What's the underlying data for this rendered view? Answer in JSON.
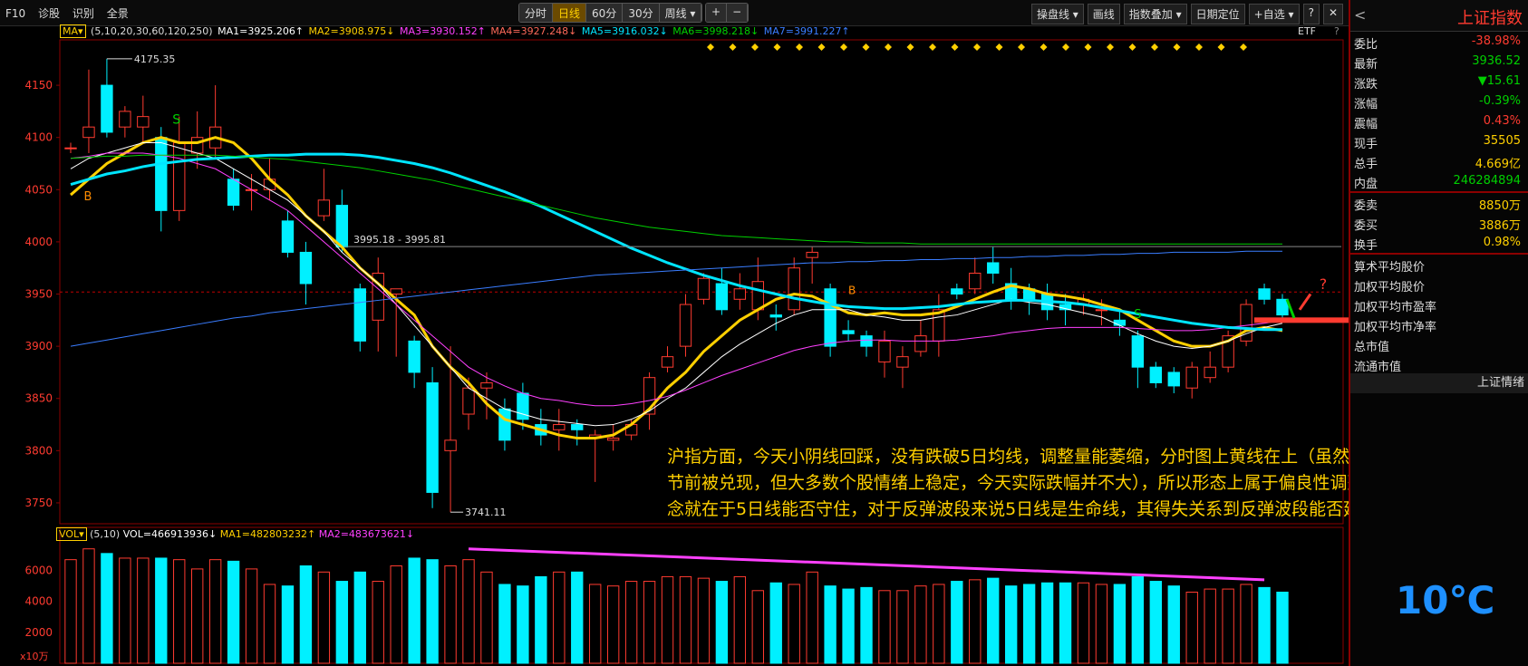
{
  "topbar": {
    "left_items": [
      "F10",
      "诊股",
      "识别",
      "全景"
    ],
    "periods": [
      "分时",
      "日线",
      "60分",
      "30分",
      "周线 ▾"
    ],
    "active_period": "日线",
    "zoom": [
      "+",
      "−"
    ],
    "right_items": [
      "操盘线 ▾",
      "画线",
      "指数叠加 ▾",
      "日期定位",
      "+自选 ▾",
      "?",
      "✕"
    ]
  },
  "ma_bar": {
    "selector": "MA▾",
    "params": "(5,10,20,30,60,120,250)",
    "items": [
      {
        "text": "MA1=3925.206↑",
        "color": "#ffffff"
      },
      {
        "text": "MA2=3908.975↓",
        "color": "#ffd000"
      },
      {
        "text": "MA3=3930.152↑",
        "color": "#ff40ff"
      },
      {
        "text": "MA4=3927.248↓",
        "color": "#ff6a5a"
      },
      {
        "text": "MA5=3916.032↓",
        "color": "#00e5ff"
      },
      {
        "text": "MA6=3998.218↓",
        "color": "#00d000"
      },
      {
        "text": "MA7=3991.227↑",
        "color": "#3a7dff"
      }
    ],
    "etf": "ETF",
    "q": "?"
  },
  "vol_bar": {
    "selector": "VOL▾",
    "params": "(5,10)",
    "items": [
      {
        "text": "VOL=466913936↓",
        "color": "#ffffff"
      },
      {
        "text": "MA1=482803232↑",
        "color": "#ffd000"
      },
      {
        "text": "MA2=483673621↓",
        "color": "#ff40ff"
      }
    ]
  },
  "chart_data": {
    "type": "candlestick",
    "y_ticks": [
      4150,
      4100,
      4050,
      4000,
      3950,
      3900,
      3850,
      3800,
      3750
    ],
    "ylim": [
      3730,
      4190
    ],
    "candles": [
      [
        4090,
        4090,
        4095,
        4085
      ],
      [
        4100,
        4110,
        4165,
        4085
      ],
      [
        4150,
        4105,
        4175.35,
        4100
      ],
      [
        4110,
        4125,
        4130,
        4100
      ],
      [
        4110,
        4120,
        4140,
        4095
      ],
      [
        4100,
        4030,
        4110,
        4010
      ],
      [
        4030,
        4095,
        4120,
        4020
      ],
      [
        4085,
        4100,
        4125,
        4070
      ],
      [
        4090,
        4110,
        4150,
        4080
      ],
      [
        4060,
        4035,
        4070,
        4030
      ],
      [
        4050,
        4050,
        4065,
        4030
      ],
      [
        4050,
        4060,
        4080,
        4040
      ],
      [
        4020,
        3990,
        4030,
        3985
      ],
      [
        3990,
        3960,
        4000,
        3940
      ],
      [
        4025,
        4040,
        4070,
        4020
      ],
      [
        4035,
        3995,
        4050,
        3990
      ],
      [
        3955,
        3905,
        3960,
        3895
      ],
      [
        3925,
        3970,
        3985,
        3895
      ],
      [
        3950,
        3955,
        3955,
        3890
      ],
      [
        3905,
        3875,
        3910,
        3860
      ],
      [
        3865,
        3760,
        3880,
        3745
      ],
      [
        3800,
        3810,
        3900,
        3741.11
      ],
      [
        3835,
        3860,
        3870,
        3820
      ],
      [
        3860,
        3865,
        3875,
        3830
      ],
      [
        3840,
        3810,
        3850,
        3800
      ],
      [
        3855,
        3830,
        3865,
        3820
      ],
      [
        3825,
        3815,
        3840,
        3805
      ],
      [
        3820,
        3825,
        3840,
        3800
      ],
      [
        3825,
        3820,
        3830,
        3805
      ],
      [
        3812,
        3815,
        3820,
        3770
      ],
      [
        3810,
        3812,
        3825,
        3800
      ],
      [
        3815,
        3825,
        3830,
        3810
      ],
      [
        3835,
        3870,
        3875,
        3820
      ],
      [
        3880,
        3890,
        3900,
        3875
      ],
      [
        3900,
        3940,
        3950,
        3890
      ],
      [
        3945,
        3965,
        3970,
        3940
      ],
      [
        3960,
        3935,
        3975,
        3930
      ],
      [
        3945,
        3955,
        3970,
        3935
      ],
      [
        3935,
        3962,
        3985,
        3925
      ],
      [
        3930,
        3928,
        3940,
        3915
      ],
      [
        3935,
        3975,
        3985,
        3930
      ],
      [
        3985,
        3990,
        3995,
        3960
      ],
      [
        3955,
        3900,
        3960,
        3890
      ],
      [
        3915,
        3912,
        3925,
        3905
      ],
      [
        3910,
        3900,
        3915,
        3890
      ],
      [
        3885,
        3905,
        3915,
        3870
      ],
      [
        3880,
        3890,
        3900,
        3860
      ],
      [
        3895,
        3910,
        3925,
        3890
      ],
      [
        3905,
        3935,
        3950,
        3890
      ],
      [
        3955,
        3950,
        3960,
        3945
      ],
      [
        3955,
        3970,
        3985,
        3950
      ],
      [
        3980,
        3970,
        3995,
        3960
      ],
      [
        3960,
        3945,
        3975,
        3935
      ],
      [
        3955,
        3945,
        3960,
        3930
      ],
      [
        3950,
        3935,
        3960,
        3925
      ],
      [
        3940,
        3935,
        3950,
        3920
      ],
      [
        3940,
        3945,
        3950,
        3930
      ],
      [
        3935,
        3935,
        3945,
        3920
      ],
      [
        3925,
        3920,
        3935,
        3910
      ],
      [
        3910,
        3880,
        3915,
        3860
      ],
      [
        3880,
        3865,
        3885,
        3860
      ],
      [
        3875,
        3862,
        3880,
        3855
      ],
      [
        3860,
        3880,
        3885,
        3850
      ],
      [
        3870,
        3880,
        3895,
        3865
      ],
      [
        3880,
        3910,
        3915,
        3875
      ],
      [
        3905,
        3940,
        3945,
        3900
      ],
      [
        3955,
        3945,
        3960,
        3940
      ],
      [
        3945,
        3930,
        3950,
        3925
      ]
    ],
    "ma_lines": [
      {
        "name": "MA5",
        "color": "#ffd000",
        "values": [
          4045,
          4060,
          4075,
          4085,
          4095,
          4100,
          4095,
          4095,
          4100,
          4095,
          4080,
          4060,
          4045,
          4025,
          4010,
          3995,
          3975,
          3960,
          3945,
          3930,
          3900,
          3880,
          3865,
          3845,
          3830,
          3825,
          3820,
          3815,
          3812,
          3812,
          3815,
          3825,
          3840,
          3860,
          3875,
          3895,
          3910,
          3925,
          3935,
          3945,
          3950,
          3948,
          3940,
          3932,
          3930,
          3932,
          3930,
          3930,
          3932,
          3938,
          3945,
          3952,
          3958,
          3955,
          3950,
          3948,
          3945,
          3940,
          3935,
          3925,
          3915,
          3905,
          3900,
          3900,
          3905,
          3915,
          3918,
          3915
        ]
      },
      {
        "name": "MA10",
        "color": "#ffffff",
        "values": [
          4070,
          4080,
          4085,
          4090,
          4095,
          4095,
          4090,
          4085,
          4080,
          4070,
          4060,
          4050,
          4040,
          4025,
          4010,
          3990,
          3975,
          3960,
          3940,
          3920,
          3900,
          3880,
          3860,
          3850,
          3840,
          3835,
          3830,
          3828,
          3826,
          3824,
          3825,
          3830,
          3838,
          3850,
          3860,
          3875,
          3890,
          3902,
          3912,
          3922,
          3930,
          3935,
          3935,
          3935,
          3930,
          3928,
          3925,
          3925,
          3928,
          3930,
          3935,
          3940,
          3945,
          3942,
          3940,
          3936,
          3932,
          3928,
          3920,
          3912,
          3905,
          3900,
          3898,
          3900,
          3905,
          3912,
          3918,
          3922
        ]
      },
      {
        "name": "MA20",
        "color": "#ff40ff",
        "values": [
          4080,
          4082,
          4085,
          4085,
          4085,
          4083,
          4080,
          4075,
          4070,
          4060,
          4050,
          4040,
          4030,
          4015,
          4000,
          3985,
          3970,
          3955,
          3940,
          3925,
          3910,
          3895,
          3880,
          3870,
          3862,
          3855,
          3850,
          3848,
          3845,
          3843,
          3843,
          3845,
          3848,
          3852,
          3858,
          3865,
          3872,
          3878,
          3884,
          3890,
          3896,
          3900,
          3903,
          3905,
          3906,
          3906,
          3905,
          3905,
          3905,
          3906,
          3908,
          3910,
          3913,
          3915,
          3917,
          3918,
          3918,
          3918,
          3918,
          3917,
          3916,
          3915,
          3915,
          3916,
          3918,
          3920,
          3922,
          3925
        ]
      },
      {
        "name": "MA60",
        "color": "#00e5ff",
        "values": [
          4055,
          4060,
          4065,
          4068,
          4072,
          4075,
          4077,
          4079,
          4080,
          4081,
          4082,
          4083,
          4083,
          4084,
          4084,
          4084,
          4083,
          4081,
          4078,
          4075,
          4071,
          4066,
          4060,
          4054,
          4048,
          4041,
          4034,
          4026,
          4018,
          4010,
          4002,
          3994,
          3987,
          3980,
          3974,
          3968,
          3963,
          3958,
          3954,
          3950,
          3946,
          3943,
          3940,
          3938,
          3937,
          3936,
          3936,
          3937,
          3938,
          3940,
          3942,
          3943,
          3944,
          3944,
          3943,
          3942,
          3940,
          3937,
          3934,
          3931,
          3928,
          3925,
          3922,
          3920,
          3918,
          3917,
          3916,
          3916
        ]
      },
      {
        "name": "MA120",
        "color": "#00d000",
        "values": [
          4080,
          4081,
          4082,
          4082,
          4083,
          4083,
          4083,
          4083,
          4083,
          4082,
          4081,
          4080,
          4079,
          4077,
          4075,
          4073,
          4071,
          4068,
          4065,
          4062,
          4059,
          4055,
          4051,
          4047,
          4043,
          4039,
          4035,
          4031,
          4027,
          4023,
          4020,
          4017,
          4014,
          4012,
          4010,
          4008,
          4006,
          4005,
          4004,
          4003,
          4002,
          4001,
          4000,
          4000,
          3999,
          3999,
          3999,
          3998,
          3998,
          3998,
          3998,
          3998,
          3998,
          3998,
          3998,
          3998,
          3998,
          3998,
          3998,
          3998,
          3998,
          3998,
          3998,
          3998,
          3998,
          3998,
          3998,
          3998
        ]
      },
      {
        "name": "MA250",
        "color": "#3a7dff",
        "values": [
          3900,
          3903,
          3906,
          3909,
          3912,
          3915,
          3918,
          3921,
          3924,
          3927,
          3929,
          3932,
          3934,
          3936,
          3938,
          3940,
          3942,
          3944,
          3946,
          3948,
          3950,
          3952,
          3954,
          3956,
          3958,
          3960,
          3962,
          3964,
          3966,
          3968,
          3969,
          3970,
          3971,
          3972,
          3973,
          3974,
          3975,
          3976,
          3977,
          3978,
          3979,
          3980,
          3980,
          3981,
          3981,
          3982,
          3982,
          3983,
          3983,
          3984,
          3984,
          3985,
          3985,
          3986,
          3986,
          3987,
          3987,
          3988,
          3988,
          3989,
          3989,
          3990,
          3990,
          3990,
          3990,
          3991,
          3991,
          3991
        ]
      }
    ],
    "volume": {
      "y_ticks": [
        6000,
        4000,
        2000
      ],
      "ylim": [
        0,
        7500
      ],
      "values": [
        6700,
        7400,
        7100,
        6800,
        6800,
        6800,
        6700,
        6100,
        6700,
        6600,
        6100,
        5100,
        5000,
        6300,
        5900,
        5300,
        5900,
        5300,
        6300,
        6800,
        6700,
        6300,
        6700,
        5900,
        5100,
        5000,
        5600,
        5900,
        5900,
        5100,
        5000,
        5300,
        5300,
        5600,
        5600,
        5500,
        5300,
        5600,
        4700,
        5200,
        5100,
        5900,
        5000,
        4800,
        4900,
        4700,
        4700,
        5000,
        5100,
        5300,
        5400,
        5500,
        5000,
        5100,
        5200,
        5200,
        5200,
        5100,
        5100,
        5600,
        5300,
        5000,
        4600,
        4800,
        4800,
        5100,
        4900,
        4600
      ]
    },
    "labels": {
      "high": "4175.35",
      "low": "3741.11",
      "range": "3995.18 - 3995.81",
      "unit": "x10万",
      "q": "?"
    }
  },
  "annotation": "沪指方面，今天小阴线回踩，没有跌破5日均线，调整量能萎缩，分时图上黄线在上（虽然部分连板题材股节前被兑现，但大多数个股情绪上稳定，今天实际跌幅并不大），所以形态上属于偏良性调整。明天的话悬念就在于5日线能否守住，对于反弹波段来说5日线是生命线，其得失关系到反弹波段能否延续。",
  "quote_panel": {
    "title": "上证指数",
    "back": "<",
    "rows1": [
      {
        "k": "委比",
        "v": "-38.98%",
        "c": "#ff3b30"
      },
      {
        "k": "最新",
        "v": "3936.52",
        "c": "#00d000"
      },
      {
        "k": "涨跌",
        "v": "▼15.61",
        "c": "#00d000"
      },
      {
        "k": "涨幅",
        "v": "-0.39%",
        "c": "#00d000"
      },
      {
        "k": "震幅",
        "v": "0.43%",
        "c": "#ff3b30"
      },
      {
        "k": "现手",
        "v": "35505",
        "c": "#ffd000"
      },
      {
        "k": "总手",
        "v": "4.669亿",
        "c": "#ffd000"
      },
      {
        "k": "内盘",
        "v": "246284894",
        "c": "#00d000"
      }
    ],
    "rows2": [
      {
        "k": "委卖",
        "v": "8850万",
        "c": "#ffd000"
      },
      {
        "k": "委买",
        "v": "3886万",
        "c": "#ffd000"
      },
      {
        "k": "换手",
        "v": "0.98%",
        "c": "#ffd000"
      }
    ],
    "links": [
      "算术平均股价",
      "加权平均股价",
      "加权平均市盈率",
      "加权平均市净率",
      "总市值",
      "流通市值"
    ],
    "footer": "上证情绪",
    "temperature": "10℃"
  }
}
